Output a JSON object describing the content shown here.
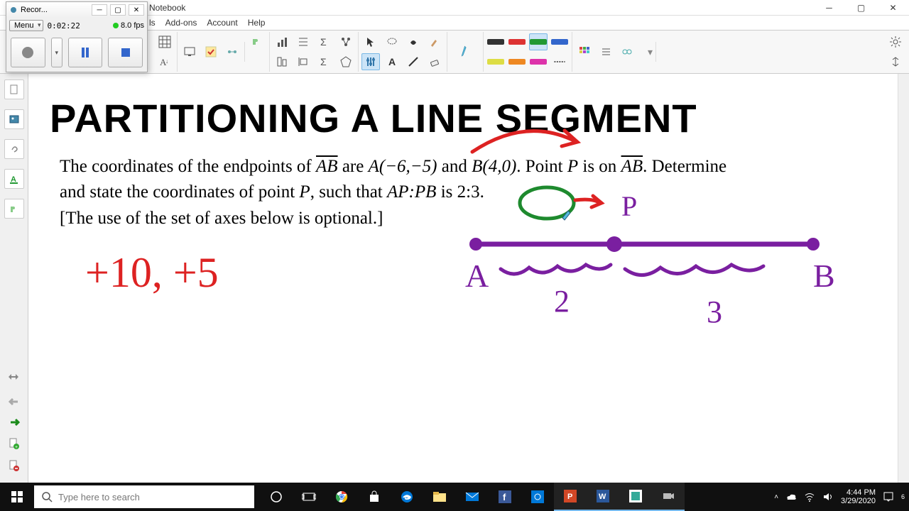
{
  "window": {
    "title": "Notebook"
  },
  "menus": {
    "items": [
      "ls",
      "Add-ons",
      "Account",
      "Help"
    ]
  },
  "recorder": {
    "title": "Recor...",
    "menu_label": "Menu",
    "time": "0:02:22",
    "fps": "8.0 fps"
  },
  "canvas": {
    "heading": "PARTITIONING A LINE SEGMENT",
    "problem_line1_pre": "The coordinates of the endpoints of ",
    "seg1": "AB",
    "problem_line1_mid": " are ",
    "ptA": "A(−6,−5)",
    "and": " and ",
    "ptB": "B(4,0)",
    "problem_line1_post": ". Point ",
    "ptP": "P",
    "on": " is on ",
    "seg2": "AB",
    "problem_line1_end": ". Determine",
    "problem_line2_pre": "and state the coordinates of point ",
    "ptP2": "P",
    "such": ", such that ",
    "ratio_lhs": "AP:PB",
    "is": " is ",
    "ratio": "2:3.",
    "problem_line3": "[The use of the set of axes below is optional.]",
    "ink_red": "+10, +5",
    "ink_P": "P",
    "ink_A": "A",
    "ink_B": "B",
    "ink_2": "2",
    "ink_3": "3"
  },
  "search": {
    "placeholder": "Type here to search"
  },
  "tray": {
    "time": "4:44 PM",
    "date": "3/29/2020"
  }
}
